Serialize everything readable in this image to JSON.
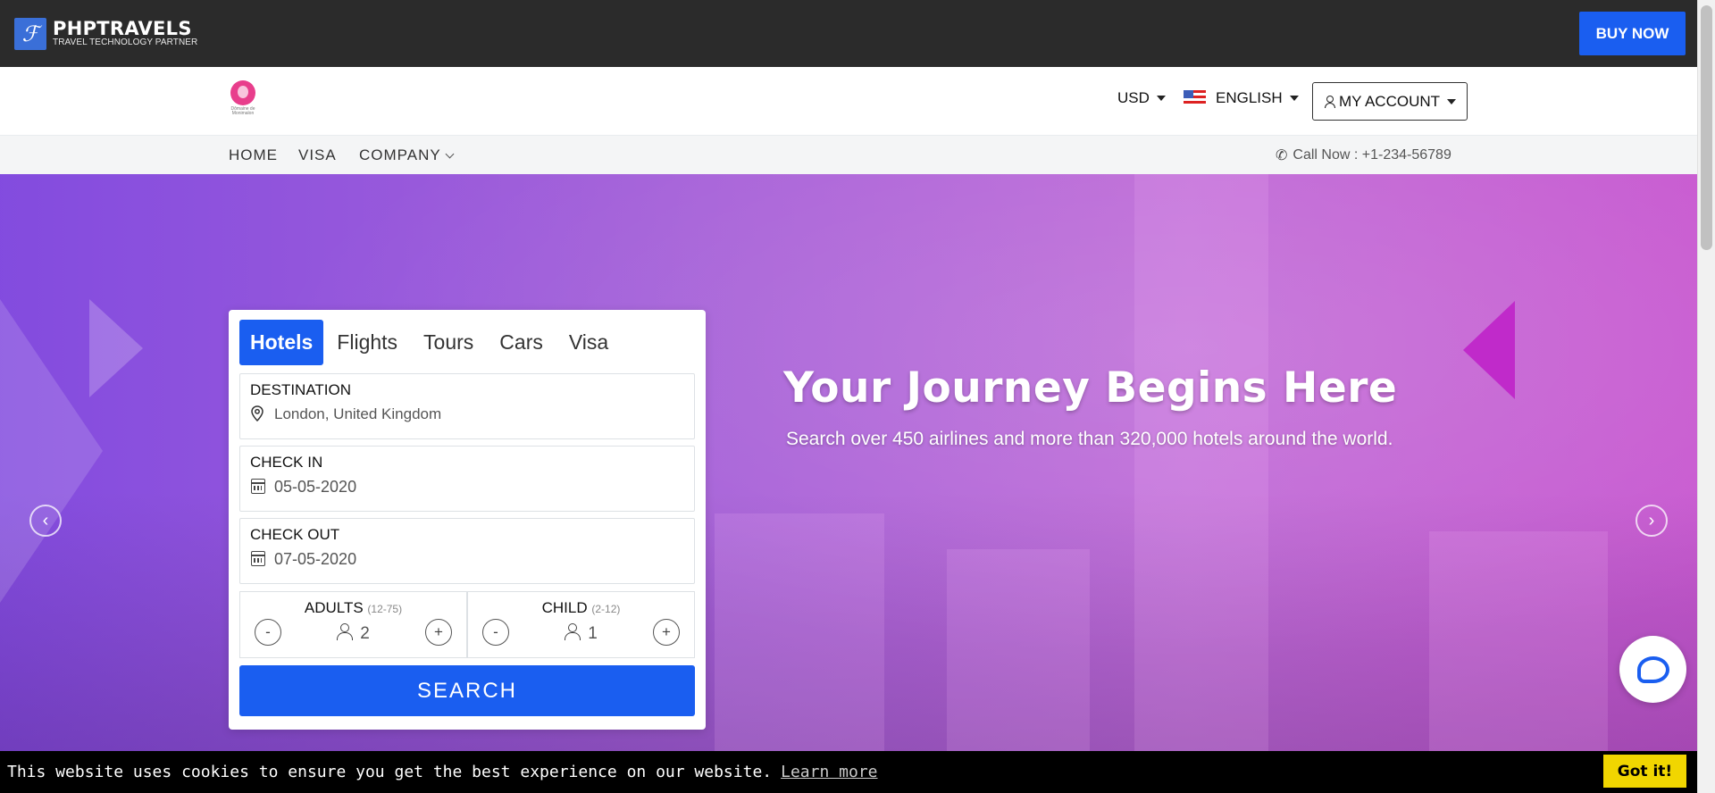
{
  "topbar": {
    "brand_name": "PHPTRAVELS",
    "brand_tagline": "TRAVEL TECHNOLOGY PARTNER",
    "buy_now": "BUY NOW"
  },
  "header": {
    "logo_caption": "Dômaine de Monimalon",
    "currency": "USD",
    "language": "ENGLISH",
    "account": "MY ACCOUNT"
  },
  "nav": {
    "items": [
      "HOME",
      "VISA",
      "COMPANY"
    ],
    "call": "Call Now : +1-234-56789"
  },
  "hero": {
    "title": "Your Journey Begins Here",
    "subtitle": "Search over 450 airlines and more than 320,000 hotels around the world."
  },
  "search": {
    "tabs": [
      "Hotels",
      "Flights",
      "Tours",
      "Cars",
      "Visa"
    ],
    "active_tab": "Hotels",
    "destination_label": "DESTINATION",
    "destination_value": "London, United Kingdom",
    "checkin_label": "CHECK IN",
    "checkin_value": "05-05-2020",
    "checkout_label": "CHECK OUT",
    "checkout_value": "07-05-2020",
    "adults_label": "ADULTS",
    "adults_range": "(12-75)",
    "adults_value": "2",
    "child_label": "CHILD",
    "child_range": "(2-12)",
    "child_value": "1",
    "minus": "-",
    "plus": "+",
    "button": "SEARCH"
  },
  "cookie": {
    "text": "This website uses cookies to ensure you get the best experience on our website.",
    "link": "Learn more",
    "button": "Got it!"
  },
  "colors": {
    "accent": "#1a5ef0",
    "topbar": "#2b2b2b",
    "cookie_button": "#f1d600"
  }
}
